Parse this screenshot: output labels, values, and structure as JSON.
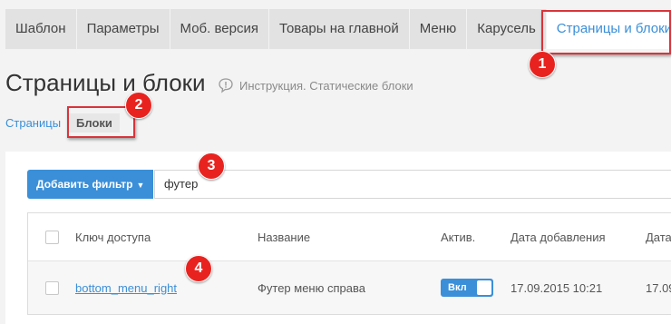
{
  "tabs": [
    {
      "label": "Шаблон"
    },
    {
      "label": "Параметры"
    },
    {
      "label": "Моб. версия"
    },
    {
      "label": "Товары на главной"
    },
    {
      "label": "Меню"
    },
    {
      "label": "Карусель"
    },
    {
      "label": "Страницы и блоки",
      "active": true
    }
  ],
  "page": {
    "title": "Страницы и блоки",
    "instruction": "Инструкция. Статические блоки"
  },
  "subnav": {
    "pages": "Страницы",
    "blocks": "Блоки"
  },
  "filter": {
    "button_label": "Добавить фильтр",
    "value": "футер"
  },
  "table": {
    "headers": {
      "key": "Ключ доступа",
      "name": "Название",
      "active": "Актив.",
      "date_added": "Дата добавления",
      "date_next": "Дата"
    },
    "rows": [
      {
        "key": "bottom_menu_right",
        "name": "Футер меню справа",
        "active": "Вкл",
        "date_added": "17.09.2015 10:21",
        "date_next": "17.09"
      }
    ]
  },
  "markers": [
    "1",
    "2",
    "3",
    "4"
  ],
  "colors": {
    "accent": "#3a8fd8",
    "marker": "#e8231f",
    "highlight": "#d9343b"
  }
}
